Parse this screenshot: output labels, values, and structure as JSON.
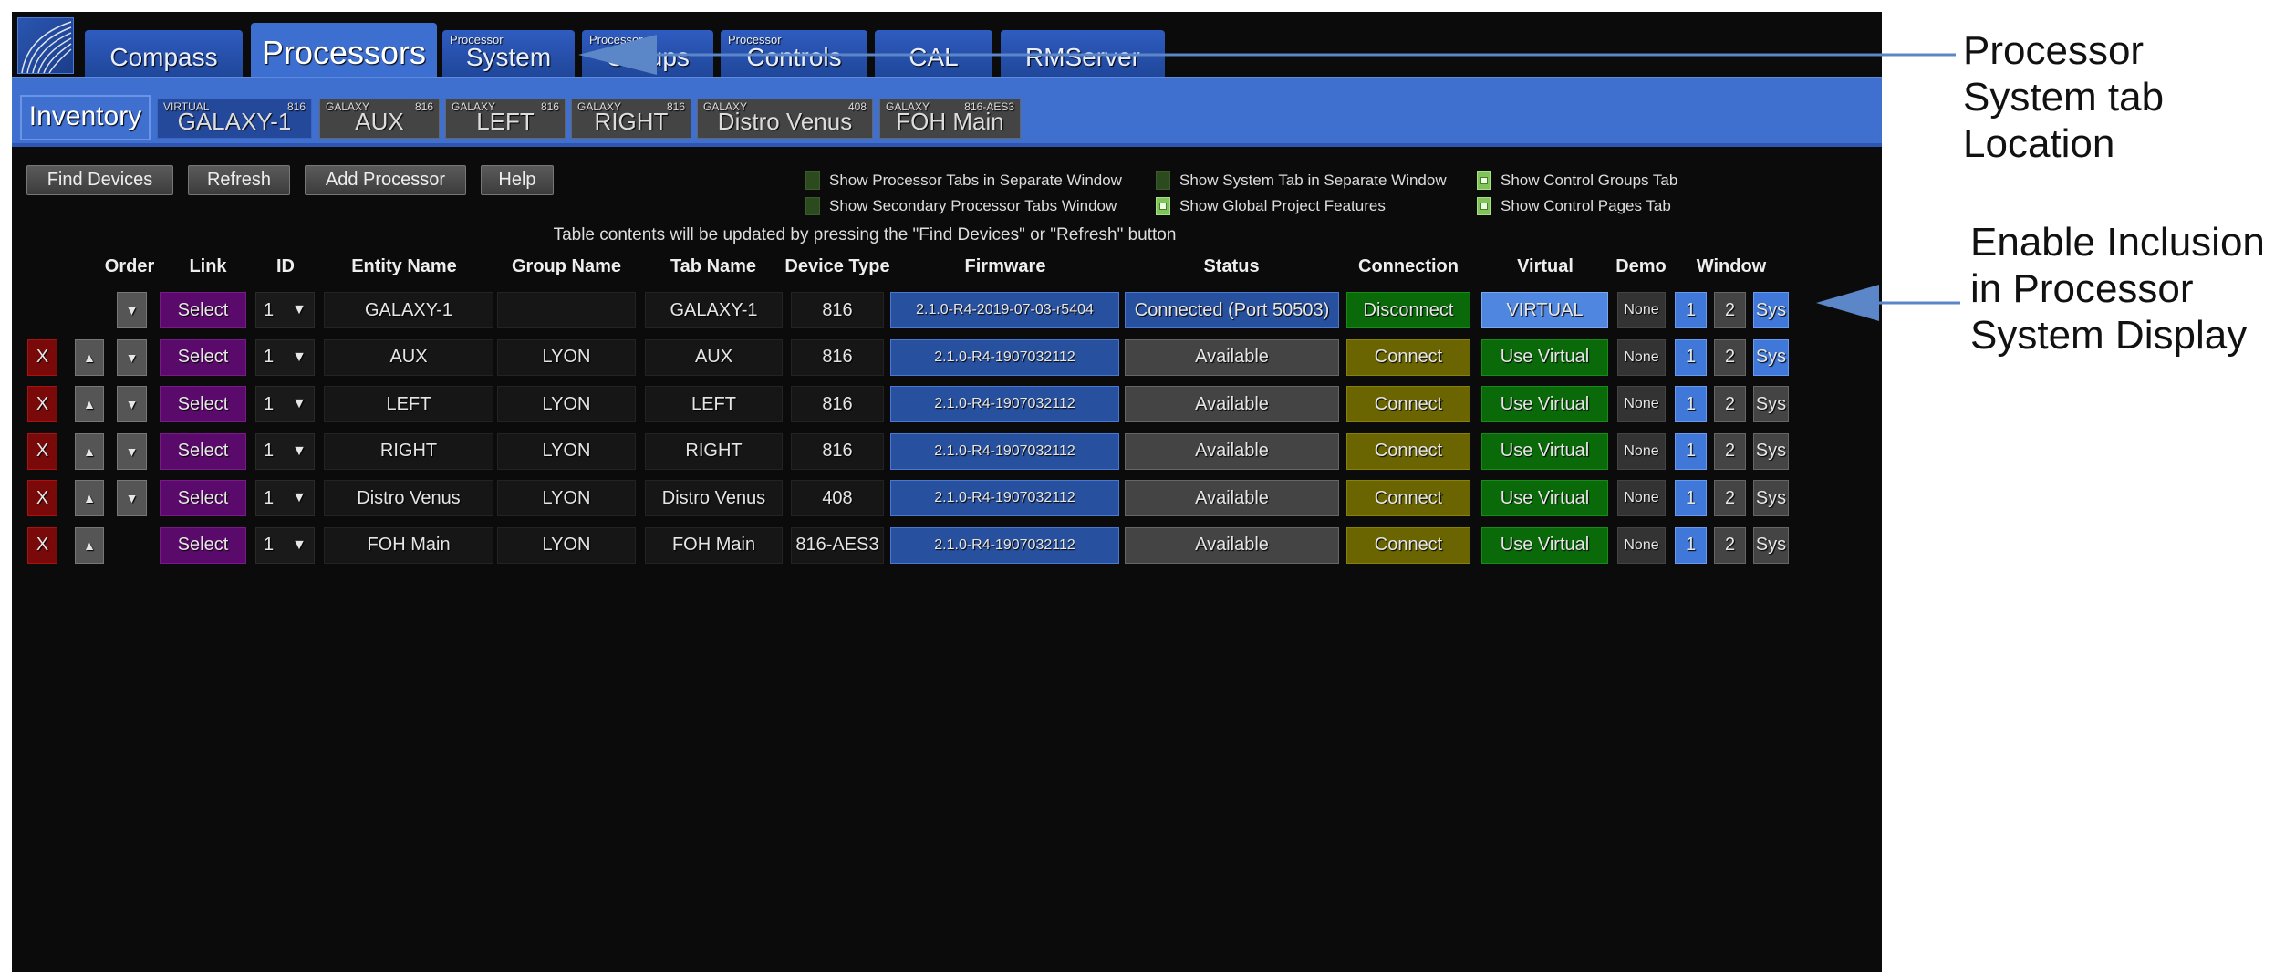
{
  "main_tabs": [
    {
      "label": "Compass",
      "sup": "",
      "active": false
    },
    {
      "label": "Processors",
      "sup": "",
      "active": true
    },
    {
      "label": "System",
      "sup": "Processor",
      "active": false
    },
    {
      "label": "Groups",
      "sup": "Processor",
      "active": false
    },
    {
      "label": "Controls",
      "sup": "Processor",
      "active": false
    },
    {
      "label": "CAL",
      "sup": "",
      "active": false
    },
    {
      "label": "RMServer",
      "sup": "",
      "active": false
    }
  ],
  "sub_tabs": [
    {
      "label": "Inventory",
      "left": "",
      "right": ""
    },
    {
      "label": "GALAXY-1",
      "left": "VIRTUAL",
      "right": "816"
    },
    {
      "label": "AUX",
      "left": "GALAXY",
      "right": "816"
    },
    {
      "label": "LEFT",
      "left": "GALAXY",
      "right": "816"
    },
    {
      "label": "RIGHT",
      "left": "GALAXY",
      "right": "816"
    },
    {
      "label": "Distro Venus",
      "left": "GALAXY",
      "right": "408"
    },
    {
      "label": "FOH Main",
      "left": "GALAXY",
      "right": "816-AES3"
    }
  ],
  "toolbar": {
    "find": "Find Devices",
    "refresh": "Refresh",
    "add": "Add Processor",
    "help": "Help"
  },
  "options": [
    {
      "label": "Show Processor Tabs in Separate Window",
      "checked": false
    },
    {
      "label": "Show Secondary Processor Tabs Window",
      "checked": false
    },
    {
      "label": "Show System Tab in Separate Window",
      "checked": false
    },
    {
      "label": "Show Global Project Features",
      "checked": true
    },
    {
      "label": "Show Control Groups Tab",
      "checked": true
    },
    {
      "label": "Show Control Pages Tab",
      "checked": true
    }
  ],
  "notice": "Table contents will be updated by pressing the \"Find Devices\" or \"Refresh\" button",
  "headers": [
    "Order",
    "Link",
    "ID",
    "Entity Name",
    "Group Name",
    "Tab Name",
    "Device Type",
    "Firmware",
    "Status",
    "Connection",
    "Virtual",
    "Demo",
    "Window"
  ],
  "rows": [
    {
      "remove": "",
      "up": false,
      "down": true,
      "link": "Select",
      "id": "1",
      "entity": "GALAXY-1",
      "group": "",
      "tab": "GALAXY-1",
      "type": "816",
      "firmware": "2.1.0-R4-2019-07-03-r5404",
      "status": "Connected (Port 50503)",
      "connection": "Disconnect",
      "virtual": "VIRTUAL",
      "demo": "None",
      "w1": "1",
      "w2": "2",
      "sys": "Sys",
      "sys_on": true
    },
    {
      "remove": "X",
      "up": true,
      "down": true,
      "link": "Select",
      "id": "1",
      "entity": "AUX",
      "group": "LYON",
      "tab": "AUX",
      "type": "816",
      "firmware": "2.1.0-R4-1907032112",
      "status": "Available",
      "connection": "Connect",
      "virtual": "Use Virtual",
      "demo": "None",
      "w1": "1",
      "w2": "2",
      "sys": "Sys",
      "sys_on": true
    },
    {
      "remove": "X",
      "up": true,
      "down": true,
      "link": "Select",
      "id": "1",
      "entity": "LEFT",
      "group": "LYON",
      "tab": "LEFT",
      "type": "816",
      "firmware": "2.1.0-R4-1907032112",
      "status": "Available",
      "connection": "Connect",
      "virtual": "Use Virtual",
      "demo": "None",
      "w1": "1",
      "w2": "2",
      "sys": "Sys",
      "sys_on": false
    },
    {
      "remove": "X",
      "up": true,
      "down": true,
      "link": "Select",
      "id": "1",
      "entity": "RIGHT",
      "group": "LYON",
      "tab": "RIGHT",
      "type": "816",
      "firmware": "2.1.0-R4-1907032112",
      "status": "Available",
      "connection": "Connect",
      "virtual": "Use Virtual",
      "demo": "None",
      "w1": "1",
      "w2": "2",
      "sys": "Sys",
      "sys_on": false
    },
    {
      "remove": "X",
      "up": true,
      "down": true,
      "link": "Select",
      "id": "1",
      "entity": "Distro Venus",
      "group": "LYON",
      "tab": "Distro Venus",
      "type": "408",
      "firmware": "2.1.0-R4-1907032112",
      "status": "Available",
      "connection": "Connect",
      "virtual": "Use Virtual",
      "demo": "None",
      "w1": "1",
      "w2": "2",
      "sys": "Sys",
      "sys_on": false
    },
    {
      "remove": "X",
      "up": true,
      "down": false,
      "link": "Select",
      "id": "1",
      "entity": "FOH Main",
      "group": "LYON",
      "tab": "FOH Main",
      "type": "816-AES3",
      "firmware": "2.1.0-R4-1907032112",
      "status": "Available",
      "connection": "Connect",
      "virtual": "Use Virtual",
      "demo": "None",
      "w1": "1",
      "w2": "2",
      "sys": "Sys",
      "sys_on": false
    }
  ],
  "annotations": {
    "system_tab": [
      "Processor",
      "System tab",
      "Location"
    ],
    "inclusion": [
      "Enable Inclusion",
      "in Processor",
      "System Display"
    ]
  },
  "colors": {
    "accent": "#3f6fcf",
    "arrow": "#5b86c8"
  }
}
